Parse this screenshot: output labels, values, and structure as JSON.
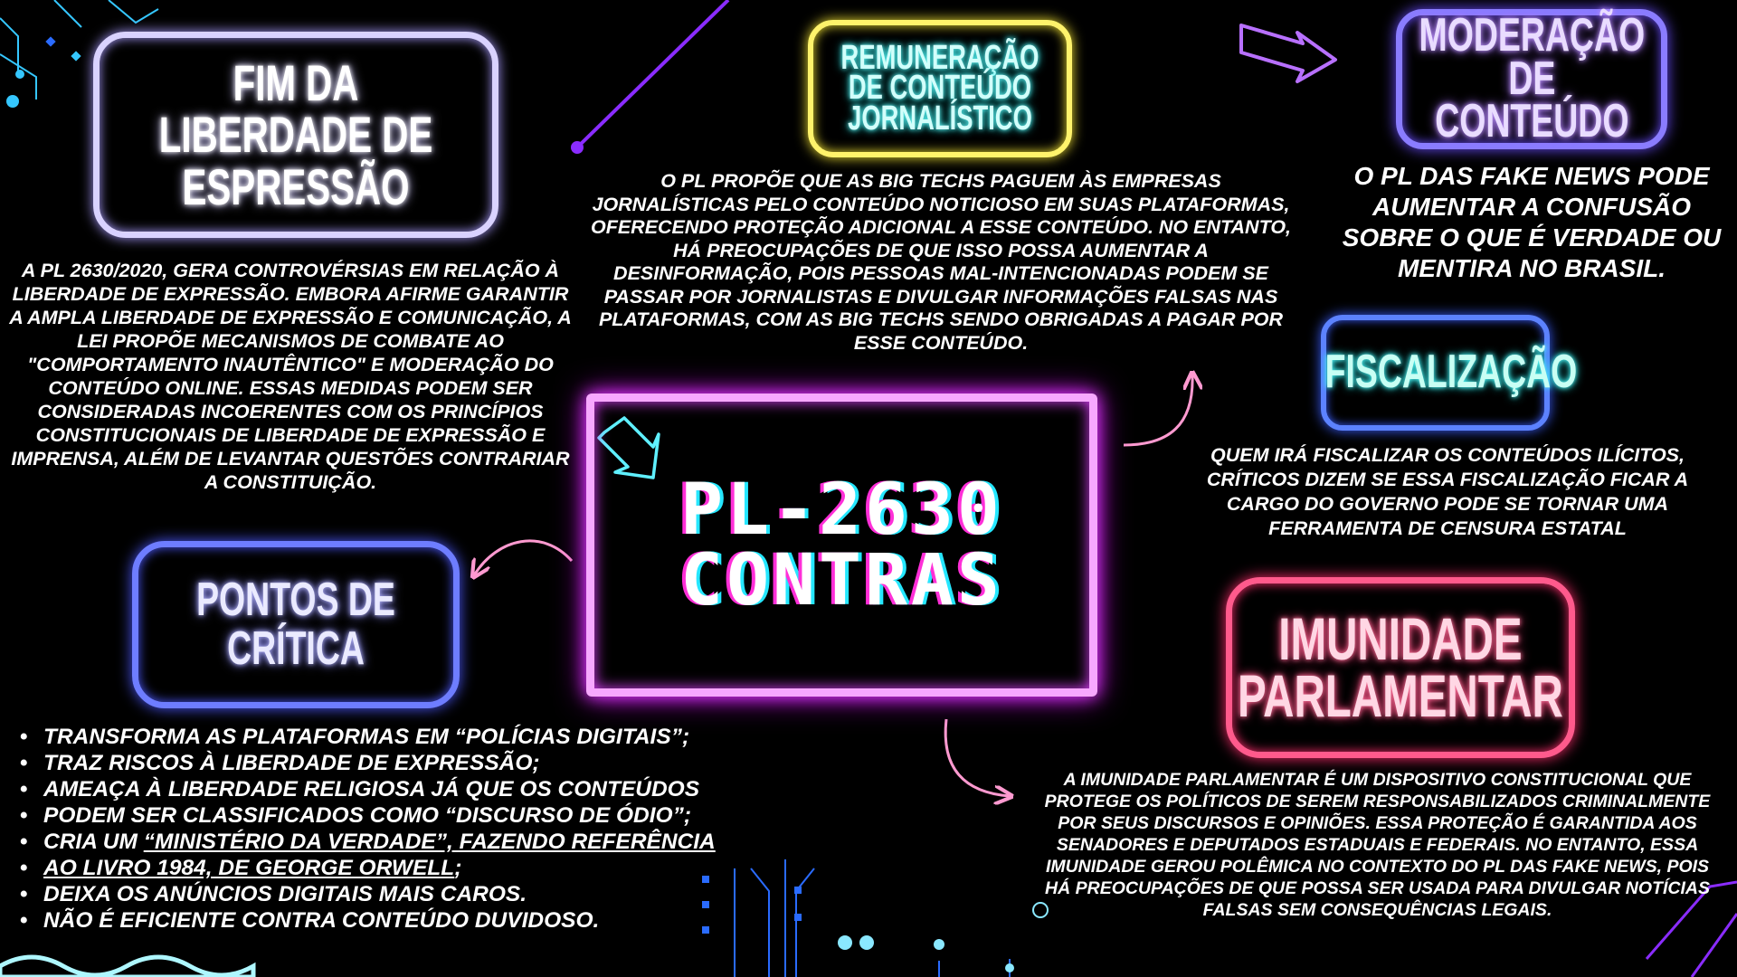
{
  "center": {
    "line1": "PL-2630",
    "line2": "CONTRAS"
  },
  "boxes": {
    "fim": "FIM DA LIBERDADE DE ESPRESSÃO",
    "remuneracao": [
      "REMUNERAÇÃO",
      "DE CONTEÚDO",
      "JORNALÍSTICO"
    ],
    "moderacao": [
      "MODERAÇÃO",
      "DE CONTEÚDO"
    ],
    "fiscalizacao": "FISCALIZAÇÃO",
    "pontos": "PONTOS DE CRÍTICA",
    "imunidade": [
      "IMUNIDADE",
      "PARLAMENTAR"
    ]
  },
  "paragraphs": {
    "fim": "A PL 2630/2020,  GERA CONTROVÉRSIAS EM RELAÇÃO À LIBERDADE DE EXPRESSÃO. EMBORA AFIRME GARANTIR A AMPLA LIBERDADE DE EXPRESSÃO E COMUNICAÇÃO, A LEI PROPÕE MECANISMOS DE COMBATE AO \"COMPORTAMENTO INAUTÊNTICO\" E MODERAÇÃO DO CONTEÚDO ONLINE. ESSAS MEDIDAS PODEM SER CONSIDERADAS INCOERENTES COM OS PRINCÍPIOS CONSTITUCIONAIS DE LIBERDADE DE EXPRESSÃO E IMPRENSA, ALÉM DE LEVANTAR QUESTÕES  CONTRARIAR A CONSTITUIÇÃO.",
    "remuneracao": "O PL PROPÕE QUE AS BIG TECHS PAGUEM ÀS EMPRESAS JORNALÍSTICAS PELO CONTEÚDO NOTICIOSO EM SUAS PLATAFORMAS, OFERECENDO PROTEÇÃO ADICIONAL A ESSE CONTEÚDO. NO ENTANTO, HÁ PREOCUPAÇÕES DE QUE ISSO POSSA AUMENTAR A DESINFORMAÇÃO, POIS PESSOAS MAL-INTENCIONADAS PODEM SE PASSAR POR JORNALISTAS E DIVULGAR INFORMAÇÕES FALSAS NAS PLATAFORMAS, COM AS BIG TECHS SENDO OBRIGADAS A PAGAR POR ESSE CONTEÚDO.",
    "moderacao": "O PL DAS FAKE NEWS PODE AUMENTAR A CONFUSÃO SOBRE O QUE É VERDADE OU MENTIRA NO BRASIL.",
    "fiscalizacao": "QUEM IRÁ FISCALIZAR OS CONTEÚDOS ILÍCITOS, CRÍTICOS DIZEM SE ESSA FISCALIZAÇÃO FICAR A CARGO DO GOVERNO PODE  SE TORNAR UMA FERRAMENTA DE CENSURA ESTATAL",
    "imunidade": "A IMUNIDADE PARLAMENTAR É UM DISPOSITIVO CONSTITUCIONAL QUE PROTEGE OS POLÍTICOS DE SEREM RESPONSABILIZADOS CRIMINALMENTE POR SEUS DISCURSOS E OPINIÕES. ESSA PROTEÇÃO É GARANTIDA AOS SENADORES E DEPUTADOS ESTADUAIS E FEDERAIS. NO ENTANTO, ESSA IMUNIDADE GEROU POLÊMICA NO CONTEXTO DO PL DAS FAKE NEWS, POIS HÁ PREOCUPAÇÕES DE QUE POSSA SER USADA PARA DIVULGAR NOTÍCIAS FALSAS SEM CONSEQUÊNCIAS LEGAIS."
  },
  "criticas": {
    "item1": "TRANSFORMA AS PLATAFORMAS EM “POLÍCIAS DIGITAIS”;",
    "item2": "TRAZ RISCOS À LIBERDADE DE EXPRESSÃO;",
    "item3": "AMEAÇA À LIBERDADE RELIGIOSA JÁ QUE OS CONTEÚDOS",
    "item4": "PODEM SER CLASSIFICADOS COMO “DISCURSO DE ÓDIO”;",
    "item5_prefix": "CRIA UM ",
    "item5_link": "“MINISTÉRIO DA VERDADE”, FAZENDO REFERÊNCIA",
    "item6_link": " AO LIVRO 1984, DE GEORGE ORWELL",
    "item6_suffix": ";",
    "item7": "DEIXA OS ANÚNCIOS DIGITAIS MAIS CAROS.",
    "item8": "NÃO É EFICIENTE CONTRA CONTEÚDO DUVIDOSO."
  },
  "colors": {
    "background": "#000000",
    "center_border": "#f7a8ff",
    "fim_border": "#d9d2ff",
    "remuneracao_border": "#fff36b",
    "moderacao_border": "#8a7cff",
    "fiscalizacao_border": "#5c82ff",
    "pontos_border": "#6e7dff",
    "imunidade_border": "#ff5a8c"
  },
  "icons": [
    "arrow-down-right-icon",
    "arrow-right-outline-icon",
    "curved-arrow-icon",
    "circuit-decoration",
    "wave-decoration"
  ]
}
